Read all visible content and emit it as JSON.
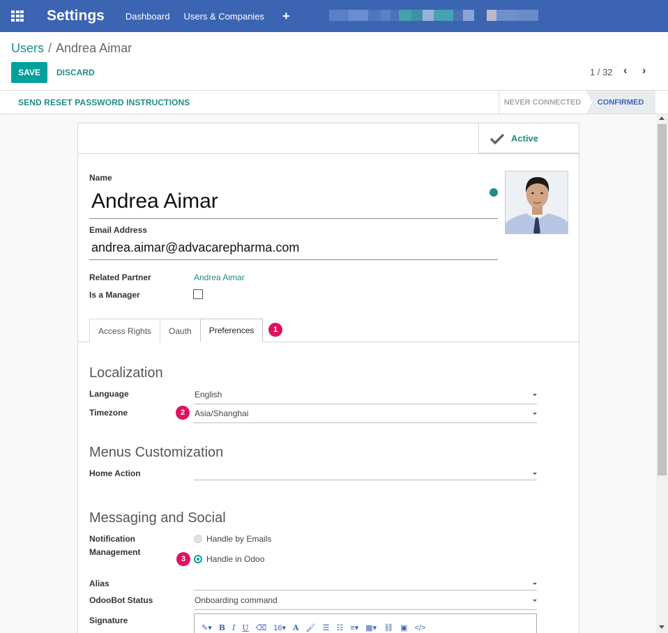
{
  "navbar": {
    "app_title": "Settings",
    "menu": [
      "Dashboard",
      "Users & Companies"
    ],
    "plus": "+"
  },
  "breadcrumb": {
    "parent": "Users",
    "separator": "/",
    "current": "Andrea Aimar"
  },
  "actions": {
    "save": "SAVE",
    "discard": "DISCARD"
  },
  "pager": {
    "value": "1 / 32",
    "prev": "‹",
    "next": "›"
  },
  "statusbar": {
    "reset_button": "SEND RESET PASSWORD INSTRUCTIONS",
    "stages": [
      "NEVER CONNECTED",
      "CONFIRMED"
    ],
    "current_stage": "CONFIRMED"
  },
  "form": {
    "active_label": "Active",
    "name_label": "Name",
    "name_value": "Andrea Aimar",
    "email_label": "Email Address",
    "email_value": "andrea.aimar@advacarepharma.com",
    "related_partner_label": "Related Partner",
    "related_partner_value": "Andrea Aimar",
    "is_manager_label": "Is a Manager",
    "is_manager_checked": false
  },
  "tabs": [
    {
      "label": "Access Rights",
      "active": false
    },
    {
      "label": "Oauth",
      "active": false
    },
    {
      "label": "Preferences",
      "active": true
    }
  ],
  "badges": [
    "1",
    "2",
    "3"
  ],
  "preferences": {
    "localization_title": "Localization",
    "language_label": "Language",
    "language_value": "English",
    "timezone_label": "Timezone",
    "timezone_value": "Asia/Shanghai",
    "menus_title": "Menus Customization",
    "home_action_label": "Home Action",
    "home_action_value": "",
    "messaging_title": "Messaging and Social",
    "notification_label_1": "Notification",
    "notification_label_2": "Management",
    "notification_options": [
      "Handle by Emails",
      "Handle in Odoo"
    ],
    "notification_selected": "Handle in Odoo",
    "alias_label": "Alias",
    "alias_value": "",
    "odoobot_label": "OdooBot Status",
    "odoobot_value": "Onboarding command",
    "signature_label": "Signature",
    "editor_font_size": "16"
  },
  "colors": {
    "navbar": "#3b64b3",
    "primary": "#00a09d",
    "link": "#1f8c87",
    "badge": "#e0115f"
  }
}
